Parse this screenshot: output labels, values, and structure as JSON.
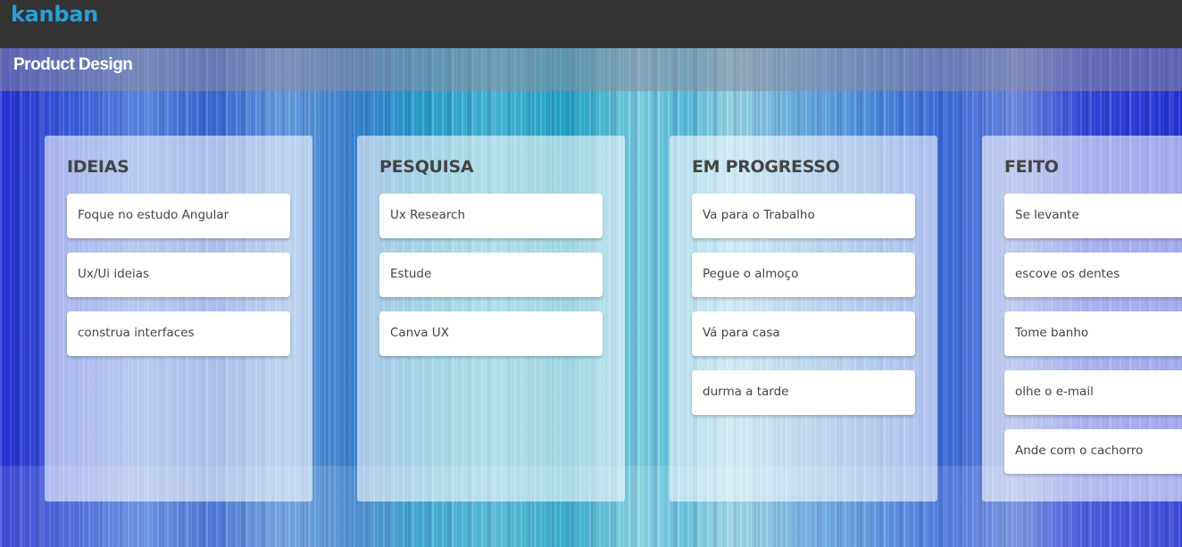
{
  "app": {
    "logo": "kanban"
  },
  "board": {
    "title": "Product Design"
  },
  "columns": [
    {
      "title": "IDEIAS",
      "cards": [
        "Foque no estudo Angular",
        "Ux/Ui ideias",
        "construa interfaces"
      ]
    },
    {
      "title": "PESQUISA",
      "cards": [
        "Ux Research",
        "Estude",
        "Canva UX"
      ]
    },
    {
      "title": "EM PROGRESSO",
      "cards": [
        "Va para o Trabalho",
        "Pegue o almoço",
        "Vá para casa",
        "durma a tarde"
      ]
    },
    {
      "title": "FEITO",
      "cards": [
        "Se levante",
        "escove os dentes",
        "Tome banho",
        "olhe o e-mail",
        "Ande com o cachorro"
      ]
    }
  ],
  "colors": {
    "topbar": "#333333",
    "logo": "#2a9fd6",
    "card_text": "#444444"
  }
}
